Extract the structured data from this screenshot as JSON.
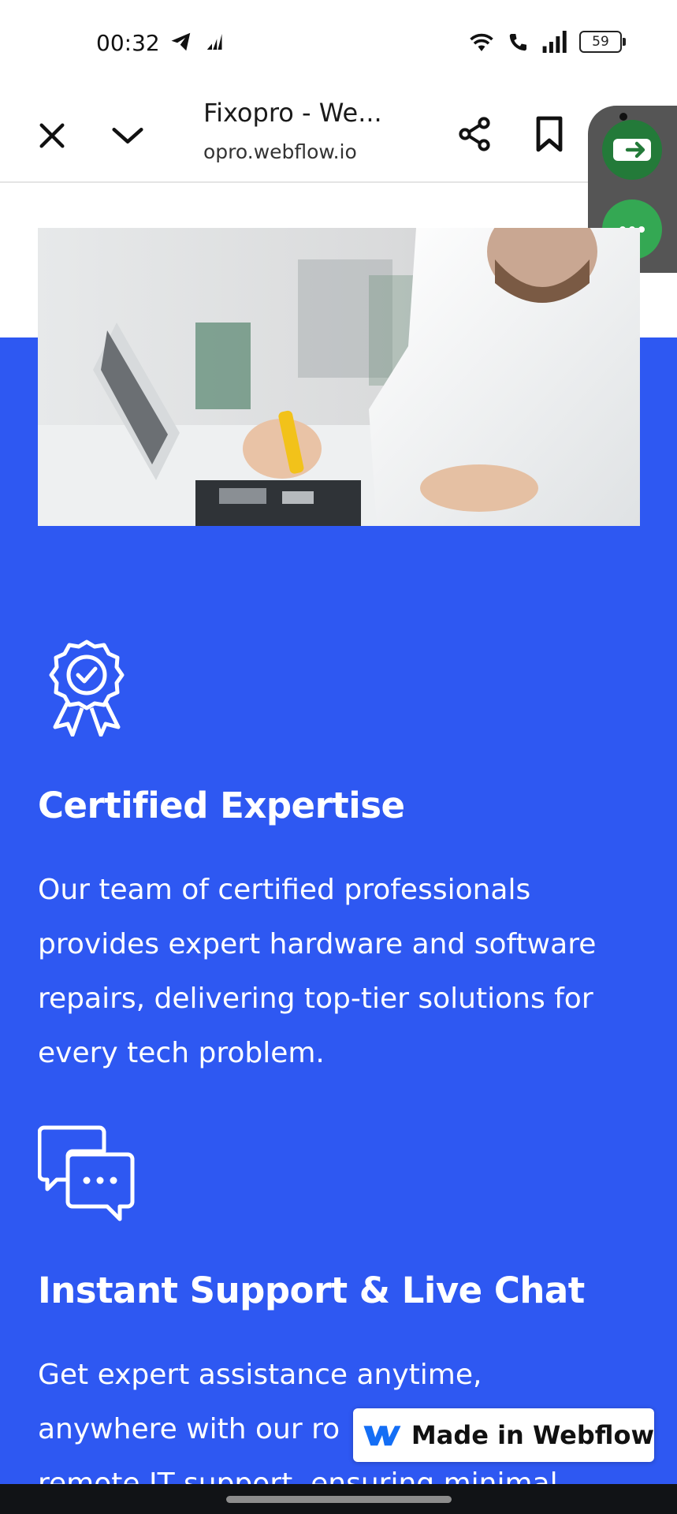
{
  "status_bar": {
    "time": "00:32",
    "battery": "59",
    "icons": [
      "telegram-icon",
      "signal-data-icon",
      "wifi-icon",
      "wifi-call-icon",
      "cell-signal-icon",
      "battery-icon"
    ]
  },
  "browser": {
    "title": "Fixopro - We...",
    "url": "opro.webflow.io"
  },
  "features": [
    {
      "icon": "award-badge-icon",
      "title": "Certified Expertise",
      "lines": [
        "Our team of certified professionals",
        "provides expert hardware and software",
        "repairs, delivering top-tier solutions for",
        "every tech problem."
      ]
    },
    {
      "icon": "chat-bubbles-icon",
      "title": "Instant Support & Live Chat",
      "lines": [
        "Get expert assistance anytime,",
        "anywhere with our ro",
        "remote IT support, ensuring minimal"
      ]
    }
  ],
  "badge": {
    "label": "Made in Webflow"
  },
  "colors": {
    "accent": "#2e58f2",
    "widget_dark": "#237a39",
    "widget_light": "#34a853"
  }
}
